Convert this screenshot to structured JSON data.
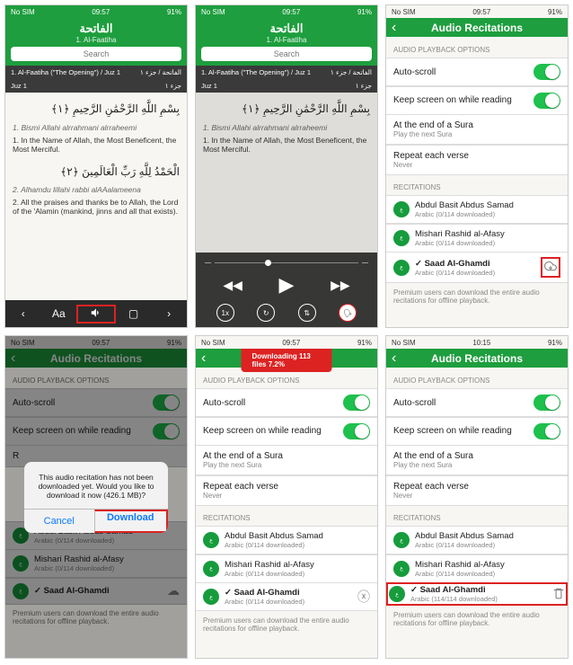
{
  "status": {
    "nosim": "No SIM",
    "time1": "09:57",
    "time2": "10:15",
    "batt": "91%"
  },
  "surah": {
    "title_ar": "الفاتحة",
    "title_en": "1. Al-Faatiha",
    "search_placeholder": "Search",
    "meta_left": "1. Al-Faatiha (\"The Opening\") / Juz 1",
    "meta_right": "الفاتحة / جزء ١",
    "juz_left": "Juz 1",
    "juz_right": "جزء ١",
    "verse1_ar": "بِسْمِ اللَّهِ الرَّحْمَٰنِ الرَّحِيمِ ﴿١﴾",
    "verse1_tr": "1. Bismi Allahi alrrahmani alrraheemi",
    "verse1_en": "1. In the Name of Allah, the Most Beneficent, the Most Merciful.",
    "verse2_ar": "الْحَمْدُ لِلَّهِ رَبِّ الْعَالَمِينَ ﴿٢﴾",
    "verse2_tr": "2. Alhamdu lillahi rabbi alAAalameena",
    "verse2_en": "2. All the praises and thanks be to Allah, the Lord of the 'Alamin (mankind, jinns and all that exists)."
  },
  "settings_title": "Audio Recitations",
  "section_playback": "AUDIO PLAYBACK OPTIONS",
  "section_recitations": "RECITATIONS",
  "playback": {
    "autoscroll": "Auto-scroll",
    "keepscreen": "Keep screen on while reading",
    "endsura": "At the end of a Sura",
    "endsura_sub": "Play the next Sura",
    "repeat": "Repeat each verse",
    "repeat_sub": "Never"
  },
  "reciters": {
    "r1_name": "Abdul Basit Abdus Samad",
    "r1_sub": "Arabic (0/114 downloaded)",
    "r2_name": "Mishari Rashid al-Afasy",
    "r2_sub": "Arabic (0/114 downloaded)",
    "r3_name_sel": "✓ Saad Al-Ghamdi",
    "r3_sub0": "Arabic (0/114 downloaded)",
    "r3_sub_full": "Arabic (114/114 downloaded)"
  },
  "footer": "Premium users can download the entire audio recitations for offline playback.",
  "alert": {
    "msg": "This audio recitation has not been downloaded yet. Would you like to download it now (426.1 MB)?",
    "cancel": "Cancel",
    "download": "Download"
  },
  "dl_banner": "Downloading 113 files 7.2%",
  "player_speed": "1x"
}
